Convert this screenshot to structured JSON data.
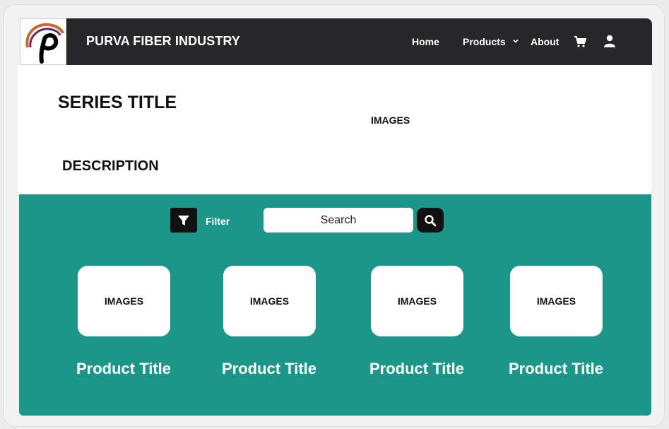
{
  "header": {
    "brand": "PURVA FIBER INDUSTRY",
    "nav": {
      "home": "Home",
      "products": "Products",
      "about": "About"
    },
    "icons": [
      "logo",
      "chevron-down-icon",
      "cart-icon",
      "user-icon"
    ]
  },
  "series": {
    "title": "SERIES TITLE",
    "images": "IMAGES",
    "description": "DESCRIPTION"
  },
  "toolbar": {
    "filter_label": "Filter",
    "search_placeholder": "Search"
  },
  "products": [
    {
      "image": "IMAGES",
      "title": "Product Title"
    },
    {
      "image": "IMAGES",
      "title": "Product Title"
    },
    {
      "image": "IMAGES",
      "title": "Product Title"
    },
    {
      "image": "IMAGES",
      "title": "Product Title"
    }
  ],
  "colors": {
    "navbar": "#272729",
    "main_bg": "#1b9689",
    "button": "#111111"
  }
}
